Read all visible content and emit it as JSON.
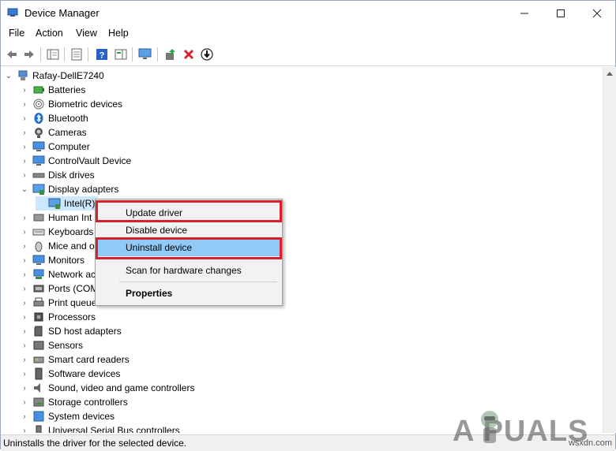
{
  "window": {
    "title": "Device Manager",
    "minimize": "—",
    "maximize": "☐",
    "close": "✕"
  },
  "menu": [
    "File",
    "Action",
    "View",
    "Help"
  ],
  "tree": {
    "root": "Rafay-DellE7240",
    "categories": [
      "Batteries",
      "Biometric devices",
      "Bluetooth",
      "Cameras",
      "Computer",
      "ControlVault Device",
      "Disk drives",
      "Display adapters"
    ],
    "display_child": "Intel(R)",
    "categories_after": [
      "Human Int",
      "Keyboards",
      "Mice and o",
      "Monitors",
      "Network ac",
      "Ports (COM",
      "Print queue",
      "Processors",
      "SD host adapters",
      "Sensors",
      "Smart card readers",
      "Software devices",
      "Sound, video and game controllers",
      "Storage controllers",
      "System devices",
      "Universal Serial Bus controllers"
    ]
  },
  "context_menu": {
    "update": "Update driver",
    "disable": "Disable device",
    "uninstall": "Uninstall device",
    "scan": "Scan for hardware changes",
    "properties": "Properties"
  },
  "status": {
    "text": "Uninstalls the driver for the selected device."
  },
  "watermark": {
    "brand": "A  PUALS",
    "site": "wsxdn.com"
  }
}
